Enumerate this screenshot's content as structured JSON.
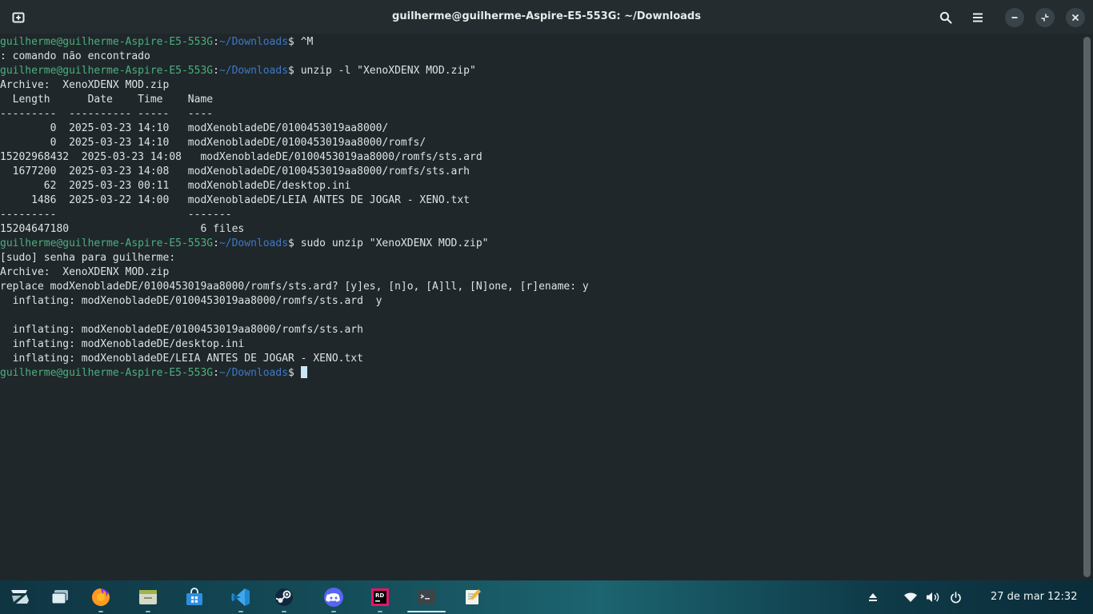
{
  "window": {
    "title": "guilherme@guilherme-Aspire-E5-553G: ~/Downloads",
    "new_tab_icon": "new-tab-icon",
    "search_icon": "search-icon",
    "menu_icon": "hamburger-menu-icon",
    "minimize_icon": "minimize-icon",
    "restore_icon": "restore-icon",
    "close_icon": "close-icon"
  },
  "terminal": {
    "prompt_user": "guilherme@guilherme-Aspire-E5-553G",
    "prompt_sep": ":",
    "prompt_path": "~/Downloads",
    "prompt_symbol": "$ ",
    "lines": [
      {
        "type": "prompt",
        "cmd": "^M"
      },
      {
        "type": "out",
        "text": ": comando não encontrado"
      },
      {
        "type": "prompt",
        "cmd": "unzip -l \"XenoXDENX MOD.zip\""
      },
      {
        "type": "out",
        "text": "Archive:  XenoXDENX MOD.zip"
      },
      {
        "type": "out",
        "text": "  Length      Date    Time    Name"
      },
      {
        "type": "out",
        "text": "---------  ---------- -----   ----"
      },
      {
        "type": "out",
        "text": "        0  2025-03-23 14:10   modXenobladeDE/0100453019aa8000/"
      },
      {
        "type": "out",
        "text": "        0  2025-03-23 14:10   modXenobladeDE/0100453019aa8000/romfs/"
      },
      {
        "type": "out",
        "text": "15202968432  2025-03-23 14:08   modXenobladeDE/0100453019aa8000/romfs/sts.ard"
      },
      {
        "type": "out",
        "text": "  1677200  2025-03-23 14:08   modXenobladeDE/0100453019aa8000/romfs/sts.arh"
      },
      {
        "type": "out",
        "text": "       62  2025-03-23 00:11   modXenobladeDE/desktop.ini"
      },
      {
        "type": "out",
        "text": "     1486  2025-03-22 14:00   modXenobladeDE/LEIA ANTES DE JOGAR - XENO.txt"
      },
      {
        "type": "out",
        "text": "---------                     -------"
      },
      {
        "type": "out",
        "text": "15204647180                     6 files"
      },
      {
        "type": "prompt",
        "cmd": "sudo unzip \"XenoXDENX MOD.zip\""
      },
      {
        "type": "out",
        "text": "[sudo] senha para guilherme:"
      },
      {
        "type": "out",
        "text": "Archive:  XenoXDENX MOD.zip"
      },
      {
        "type": "out",
        "text": "replace modXenobladeDE/0100453019aa8000/romfs/sts.ard? [y]es, [n]o, [A]ll, [N]one, [r]ename: y"
      },
      {
        "type": "out",
        "text": "  inflating: modXenobladeDE/0100453019aa8000/romfs/sts.ard  y"
      },
      {
        "type": "out",
        "text": ""
      },
      {
        "type": "out",
        "text": "  inflating: modXenobladeDE/0100453019aa8000/romfs/sts.arh"
      },
      {
        "type": "out",
        "text": "  inflating: modXenobladeDE/desktop.ini"
      },
      {
        "type": "out",
        "text": "  inflating: modXenobladeDE/LEIA ANTES DE JOGAR - XENO.txt"
      },
      {
        "type": "cursor",
        "cmd": ""
      }
    ]
  },
  "taskbar": {
    "apps": [
      {
        "name": "zorin-menu-icon",
        "active": false
      },
      {
        "name": "workspaces-icon",
        "active": false
      },
      {
        "name": "firefox-icon",
        "active": true
      },
      {
        "name": "files-icon",
        "active": true
      },
      {
        "name": "software-store-icon",
        "active": false
      },
      {
        "name": "vscode-icon",
        "active": true
      },
      {
        "name": "steam-icon",
        "active": true
      },
      {
        "name": "discord-icon",
        "active": true
      },
      {
        "name": "rider-icon",
        "active": true
      },
      {
        "name": "terminal-icon",
        "active": true
      },
      {
        "name": "text-editor-icon",
        "active": false
      }
    ],
    "tray": {
      "date": "27 de mar",
      "time": "12:32"
    }
  },
  "colors": {
    "prompt_user": "#4caf7d",
    "prompt_path": "#3d79c7",
    "text": "#dde3e3",
    "background": "#1f272a",
    "cursor": "#c8e6f8"
  }
}
